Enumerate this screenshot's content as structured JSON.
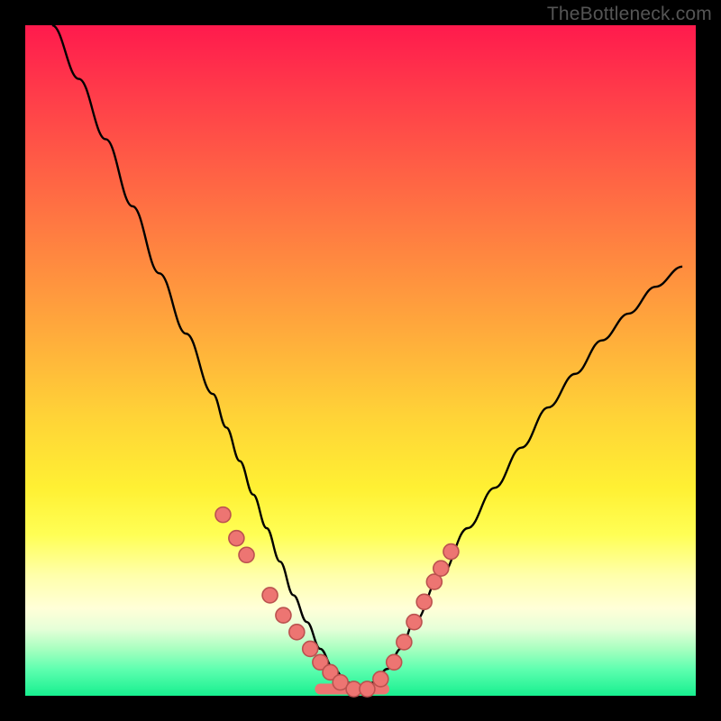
{
  "watermark": "TheBottleneck.com",
  "colors": {
    "gradient_top": "#ff1a4d",
    "gradient_bottom": "#17ef8f",
    "curve": "#000000",
    "marker_fill": "#ed7572",
    "marker_stroke": "#bb524f",
    "background": "#000000"
  },
  "chart_data": {
    "type": "line",
    "title": "",
    "xlabel": "",
    "ylabel": "",
    "xlim": [
      0,
      100
    ],
    "ylim": [
      0,
      100
    ],
    "grid": false,
    "legend": false,
    "series": [
      {
        "name": "bottleneck-curve",
        "x": [
          4,
          8,
          12,
          16,
          20,
          24,
          28,
          30,
          32,
          34,
          36,
          38,
          40,
          42,
          44,
          46,
          48,
          50,
          52,
          54,
          56,
          58,
          62,
          66,
          70,
          74,
          78,
          82,
          86,
          90,
          94,
          98
        ],
        "y": [
          100,
          92,
          83,
          73,
          63,
          54,
          45,
          40,
          35,
          30,
          25,
          20,
          15,
          11,
          7,
          4,
          2,
          1,
          2,
          4,
          7,
          11,
          18,
          25,
          31,
          37,
          43,
          48,
          53,
          57,
          61,
          64
        ]
      }
    ],
    "markers": {
      "name": "highlight-points",
      "x": [
        29.5,
        31.5,
        33.0,
        36.5,
        38.5,
        40.5,
        42.5,
        44.0,
        45.5,
        47.0,
        49.0,
        51.0,
        53.0,
        55.0,
        56.5,
        58.0,
        59.5,
        61.0,
        62.0,
        63.5
      ],
      "y": [
        27.0,
        23.5,
        21.0,
        15.0,
        12.0,
        9.5,
        7.0,
        5.0,
        3.5,
        2.0,
        1.0,
        1.0,
        2.5,
        5.0,
        8.0,
        11.0,
        14.0,
        17.0,
        19.0,
        21.5
      ]
    },
    "plateau": {
      "x0": 44.0,
      "x1": 53.5,
      "y": 1.0
    }
  }
}
